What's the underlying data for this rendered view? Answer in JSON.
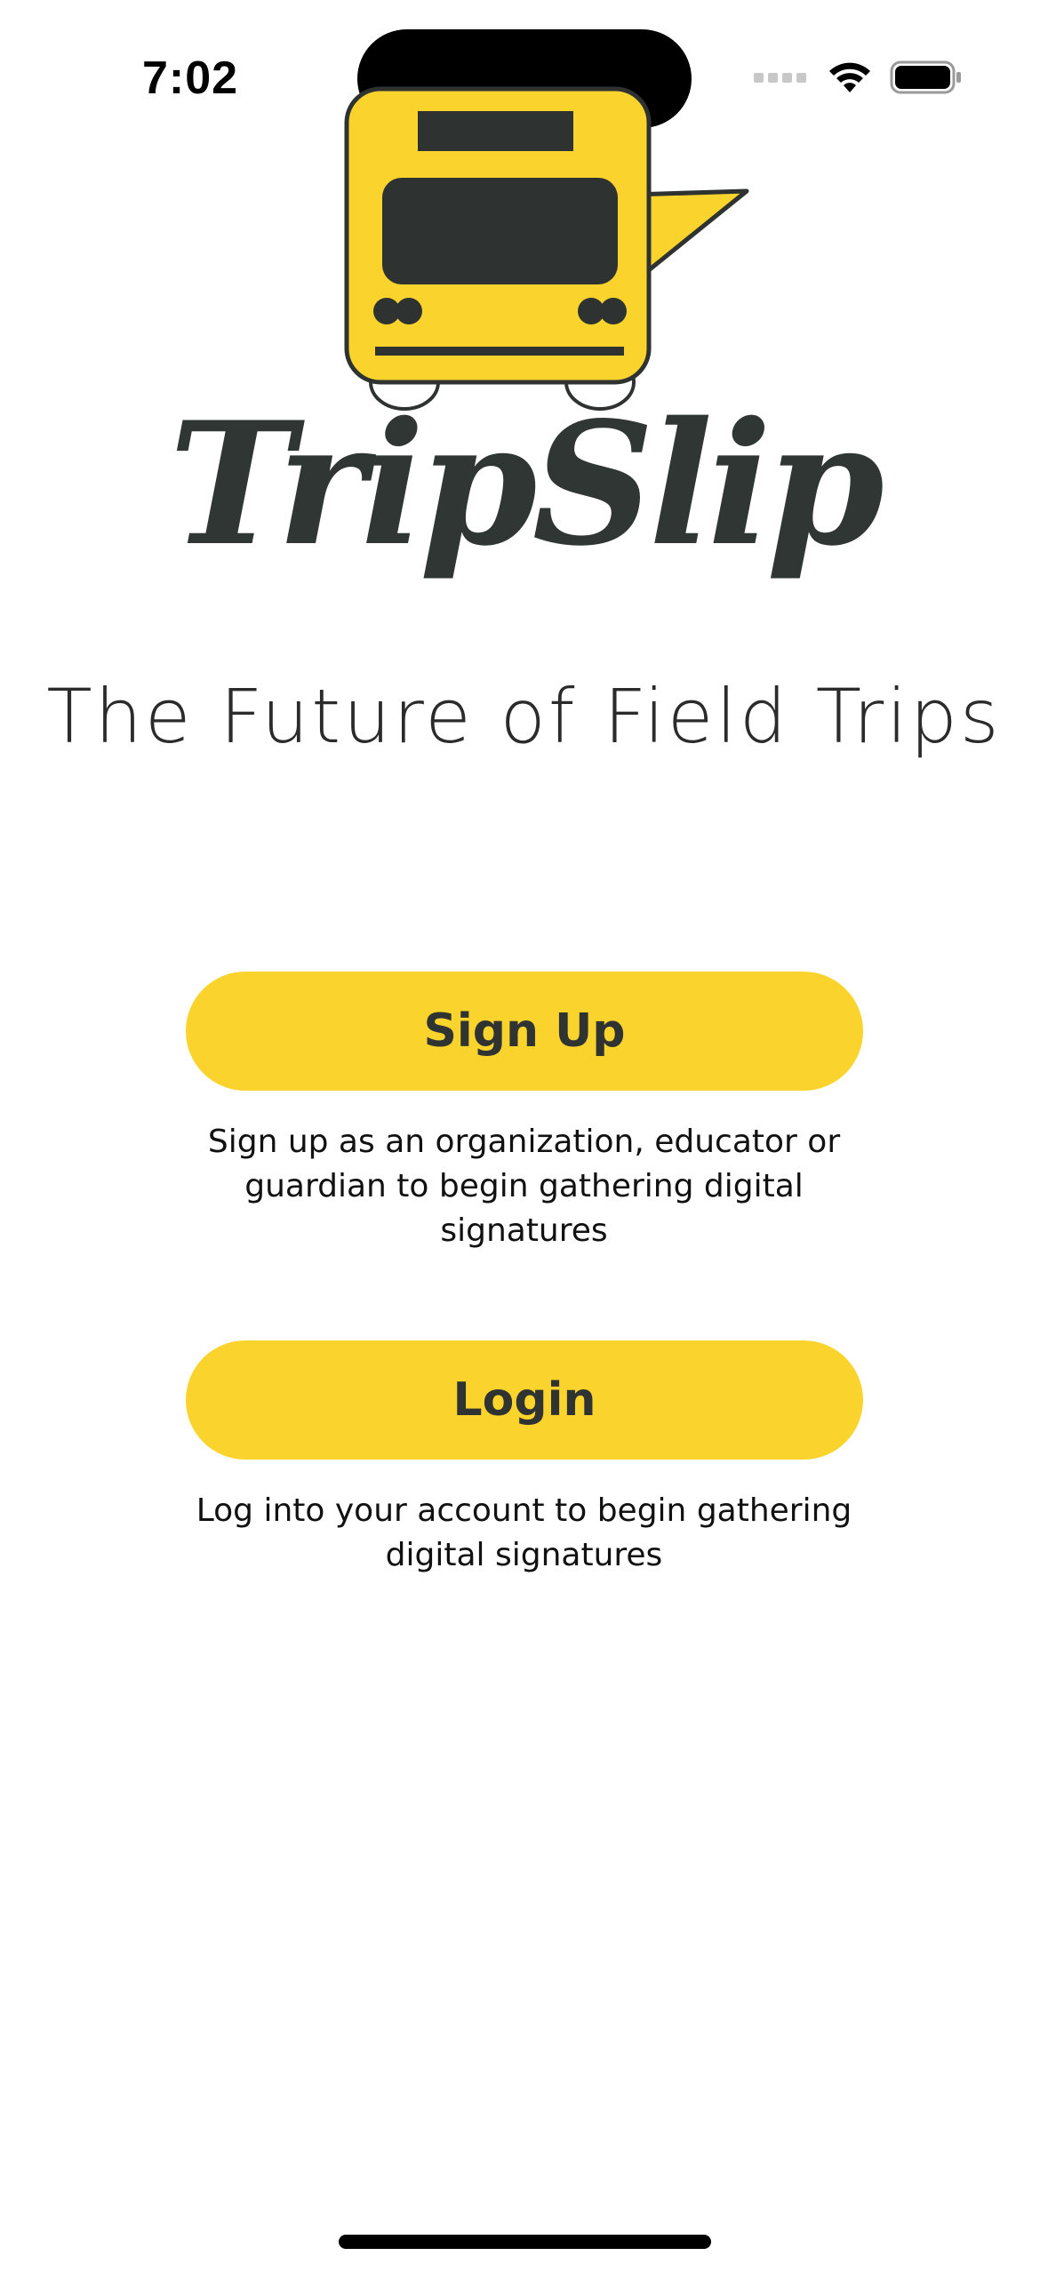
{
  "status_bar": {
    "time": "7:02"
  },
  "brand": {
    "name": "TripSlip",
    "tagline": "The Future of Field Trips",
    "logo_icon": "school-bus-speech-bubble-icon",
    "brand_yellow": "#fbd32d",
    "brand_dark": "#2f3634"
  },
  "actions": {
    "signup": {
      "label": "Sign Up",
      "description": "Sign up as an organization, educator or guardian to begin gathering digital signatures"
    },
    "login": {
      "label": "Login",
      "description": "Log into your account to begin gathering digital signatures"
    }
  }
}
